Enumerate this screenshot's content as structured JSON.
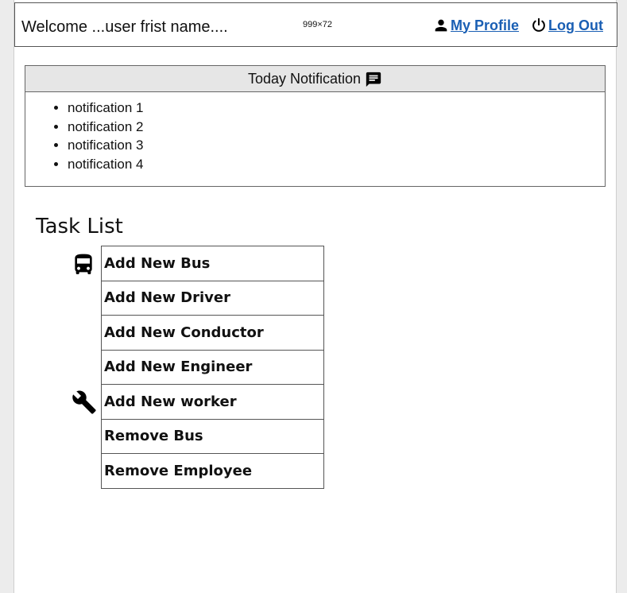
{
  "header": {
    "welcome_text": "Welcome ...user frist name....",
    "dims_text": "999×72",
    "profile_label": "My Profile",
    "logout_label": "Log Out",
    "icons": [
      "person-icon",
      "power-icon"
    ],
    "link_color": "#1a5fb4"
  },
  "notifications": {
    "title": "Today Notification",
    "icon": "message-icon",
    "items": [
      {
        "label": "notification 1"
      },
      {
        "label": "notification 2"
      },
      {
        "label": "notification 3"
      },
      {
        "label": "notification 4"
      }
    ]
  },
  "tasks": {
    "title": "Task List",
    "side_icons": [
      "bus-icon",
      "wrench-icon"
    ],
    "items": [
      {
        "label": "Add New Bus"
      },
      {
        "label": "Add New Driver"
      },
      {
        "label": "Add New Conductor"
      },
      {
        "label": "Add New Engineer"
      },
      {
        "label": "Add New worker"
      },
      {
        "label": "Remove Bus"
      },
      {
        "label": "Remove Employee"
      }
    ]
  }
}
